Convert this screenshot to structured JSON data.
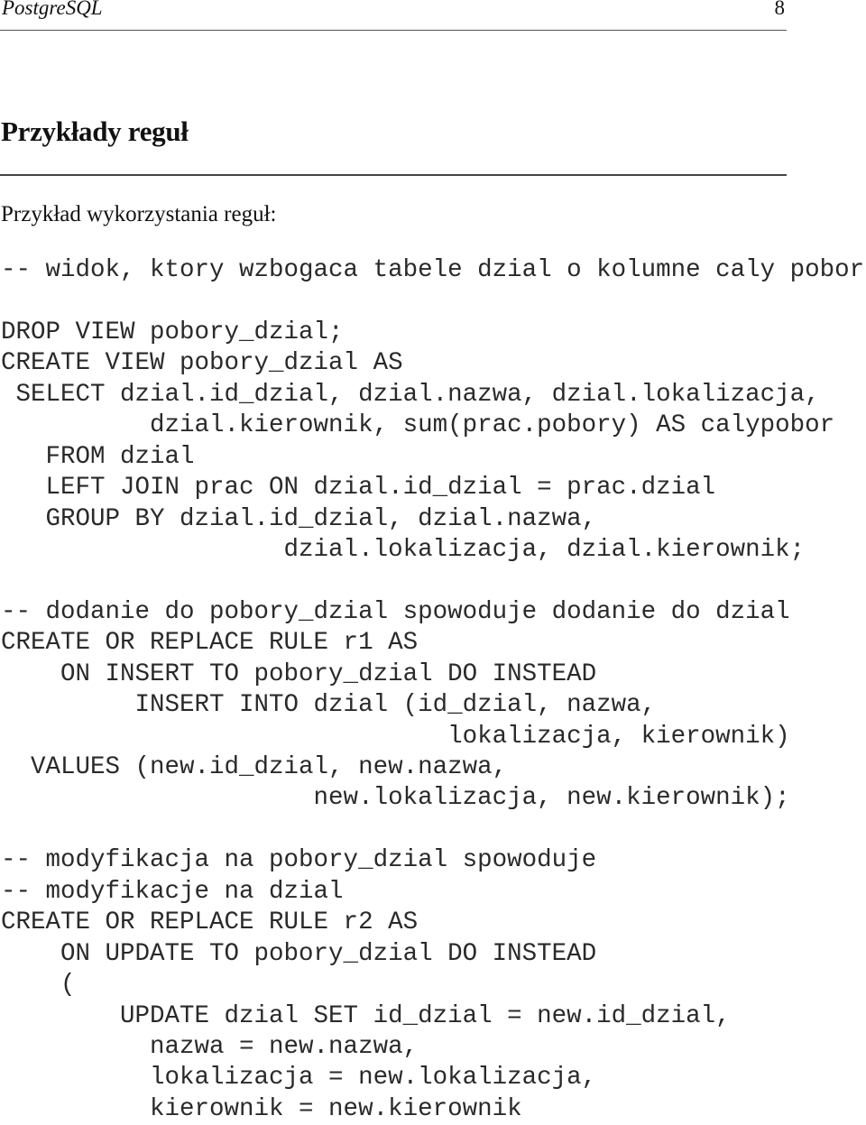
{
  "header": {
    "running_title": "PostgreSQL",
    "page_number": "8"
  },
  "section": {
    "title": "Przykłady reguł",
    "intro": "Przykład wykorzystania reguł:"
  },
  "code_lines": [
    {
      "text": "-- widok, ktory wzbogaca tabele dzial o kolumne caly pobor",
      "kind": "comment"
    },
    {
      "text": "",
      "kind": "blank"
    },
    {
      "text": "DROP VIEW pobory_dzial;",
      "kind": "code"
    },
    {
      "text": "CREATE VIEW pobory_dzial AS",
      "kind": "code"
    },
    {
      "text": " SELECT dzial.id_dzial, dzial.nazwa, dzial.lokalizacja,",
      "kind": "code"
    },
    {
      "text": "          dzial.kierownik, sum(prac.pobory) AS calypobor",
      "kind": "code"
    },
    {
      "text": "   FROM dzial",
      "kind": "code"
    },
    {
      "text": "   LEFT JOIN prac ON dzial.id_dzial = prac.dzial",
      "kind": "code"
    },
    {
      "text": "   GROUP BY dzial.id_dzial, dzial.nazwa,",
      "kind": "code"
    },
    {
      "text": "                   dzial.lokalizacja, dzial.kierownik;",
      "kind": "code"
    },
    {
      "text": "",
      "kind": "blank"
    },
    {
      "text": "-- dodanie do pobory_dzial spowoduje dodanie do dzial",
      "kind": "comment"
    },
    {
      "text": "CREATE OR REPLACE RULE r1 AS",
      "kind": "code"
    },
    {
      "text": "    ON INSERT TO pobory_dzial DO INSTEAD",
      "kind": "code"
    },
    {
      "text": "         INSERT INTO dzial (id_dzial, nazwa,",
      "kind": "code"
    },
    {
      "text": "                              lokalizacja, kierownik)",
      "kind": "code"
    },
    {
      "text": "  VALUES (new.id_dzial, new.nazwa,",
      "kind": "code"
    },
    {
      "text": "                     new.lokalizacja, new.kierownik);",
      "kind": "code"
    },
    {
      "text": "",
      "kind": "blank"
    },
    {
      "text": "-- modyfikacja na pobory_dzial spowoduje",
      "kind": "comment"
    },
    {
      "text": "-- modyfikacje na dzial",
      "kind": "comment"
    },
    {
      "text": "CREATE OR REPLACE RULE r2 AS",
      "kind": "code"
    },
    {
      "text": "    ON UPDATE TO pobory_dzial DO INSTEAD",
      "kind": "code"
    },
    {
      "text": "    (",
      "kind": "code"
    },
    {
      "text": "        UPDATE dzial SET id_dzial = new.id_dzial,",
      "kind": "code"
    },
    {
      "text": "          nazwa = new.nazwa,",
      "kind": "code"
    },
    {
      "text": "          lokalizacja = new.lokalizacja,",
      "kind": "code"
    },
    {
      "text": "          kierownik = new.kierownik",
      "kind": "code"
    }
  ]
}
